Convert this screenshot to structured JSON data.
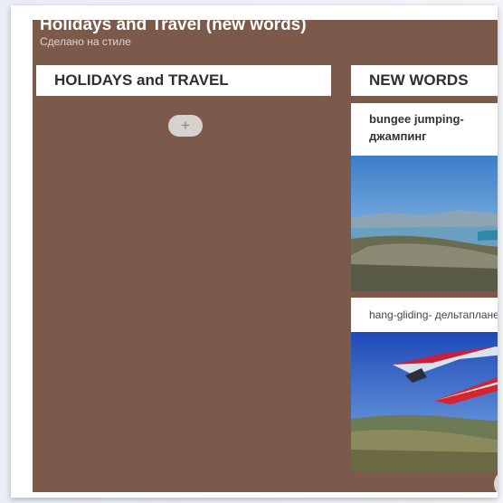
{
  "board": {
    "title": "Holidays and Travel (new words)",
    "subtitle": "Сделано на стиле",
    "background_color": "#7b5a4b"
  },
  "columns": [
    {
      "header": "HOLIDAYS and TRAVEL",
      "add_icon": "plus-icon",
      "add_label": "+"
    },
    {
      "header": "NEW WORDS",
      "cards": [
        {
          "title_line1": "bungee jumping-",
          "title_line2": "джампинг",
          "image": "coastal-landscape-photo"
        },
        {
          "title_line1": "hang-gliding- дельтапланеризм",
          "image": "hang-glider-photo"
        }
      ]
    }
  ]
}
